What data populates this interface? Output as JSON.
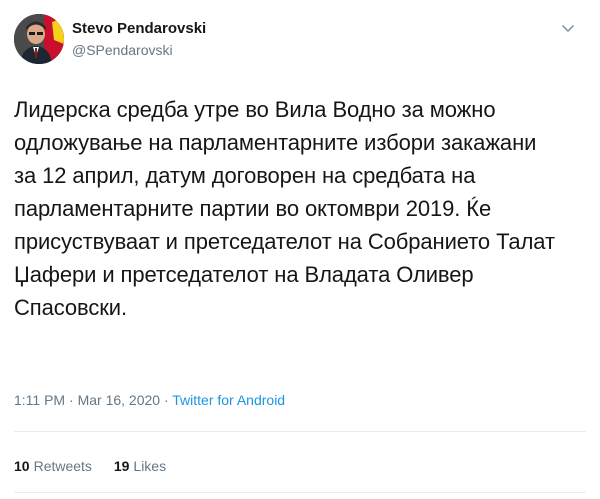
{
  "author": {
    "display_name": "Stevo Pendarovski",
    "handle": "@SPendarovski",
    "avatar_icon": "profile-photo"
  },
  "tweet": {
    "text": "Лидерска средба утре во Вила Водно за можно\nодложување на парламентарните избори закажани\nза 12 април, датум договорен на средбата на\nпарламентарните партии во октомври 2019. Ќе\nприсуствуваат и претседателот на Собранието Талат\nЏафери и претседателот на Владата Оливер\nСпасовски.",
    "time": "1:11 PM",
    "separator": " · ",
    "date": "Mar 16, 2020",
    "source": "Twitter for Android"
  },
  "stats": {
    "retweets_count": "10",
    "retweets_label": "Retweets",
    "likes_count": "19",
    "likes_label": "Likes"
  },
  "icons": {
    "menu": "chevron-down-icon"
  },
  "colors": {
    "text": "#14171a",
    "secondary": "#657786",
    "link": "#1b95e0",
    "divider": "#e6ecf0"
  }
}
